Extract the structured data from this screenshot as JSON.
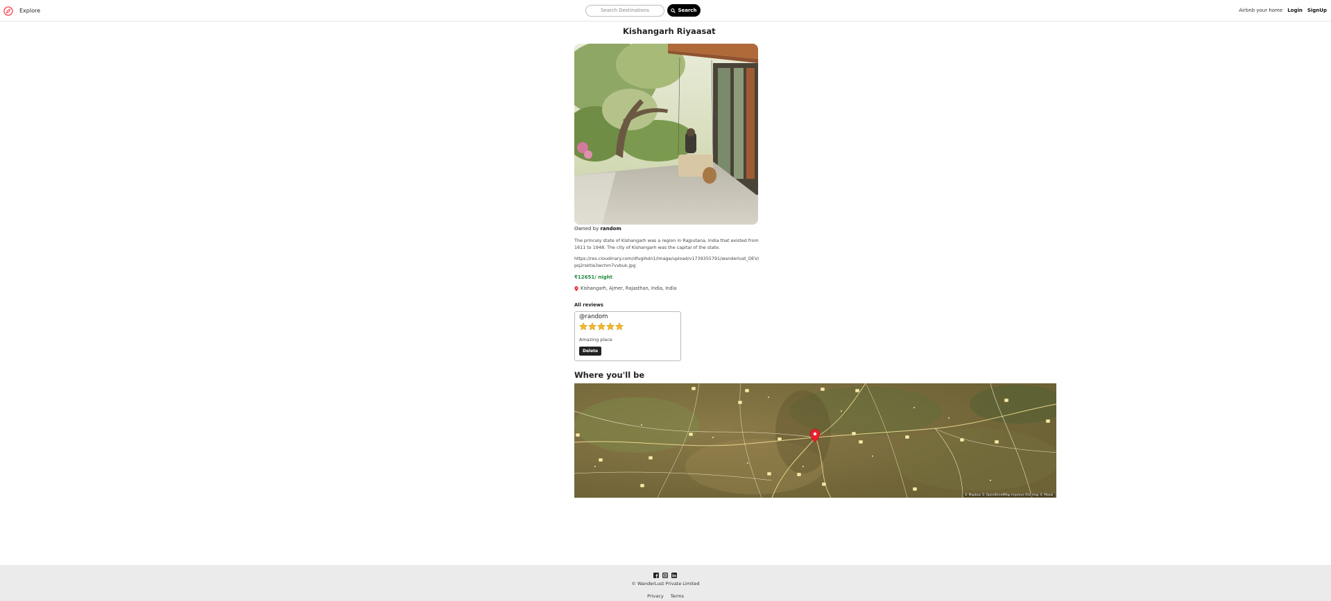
{
  "nav": {
    "logo_icon": "compass-icon",
    "brand_color": "#fe424d",
    "explore_label": "Explore",
    "search_placeholder": "Search Destinations",
    "search_button_label": "Search",
    "airbnb_label": "Airbnb your home",
    "login_label": "Login",
    "signup_label": "SignUp"
  },
  "listing": {
    "title": "Kishangarh Riyaasat",
    "owner_prefix": "Owned by ",
    "owner": "random",
    "description": "The princely state of Kishangarh was a region in Rajputana, India that existed from 1611 to 1948. The city of Kishangarh was the capital of the state.",
    "image_url": "https://res.cloudinary.com/dfugihdn1/image/upload/v1739355791/wanderlust_DEV/pq2rsktla3wchm7vvbuk.jpg",
    "price": "₹12651/ night",
    "location": "Kishangarh, Ajmer, Rajasthan, India, India",
    "price_color": "#1f8a3f"
  },
  "reviews": {
    "heading": "All reviews",
    "items": [
      {
        "author": "@random",
        "rating": 5,
        "comment": "Amazing place",
        "delete_label": "Delete"
      }
    ]
  },
  "map": {
    "heading": "Where you'll be",
    "attribution": "© Mapbox © OpenStreetMap Improve this map © Maxar",
    "marker_color": "#e8212b"
  },
  "footer": {
    "social_icons": [
      "facebook-icon",
      "instagram-icon",
      "linkedin-icon"
    ],
    "copyright": "© WanderLust Private Limited",
    "privacy_label": "Privacy",
    "terms_label": "Terms"
  }
}
